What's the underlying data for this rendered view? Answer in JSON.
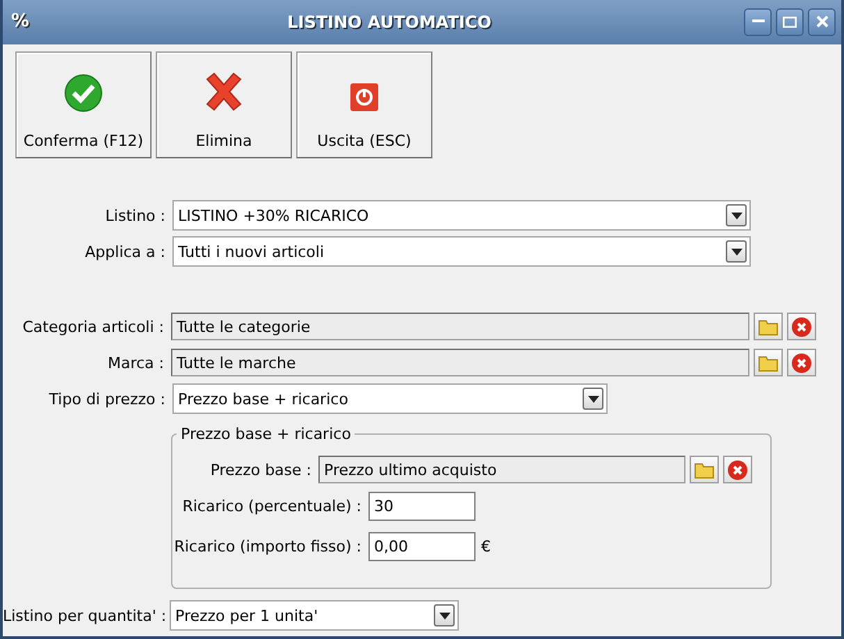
{
  "window": {
    "title": "LISTINO AUTOMATICO",
    "icon": "%"
  },
  "toolbar": [
    {
      "label": "Conferma (F12)",
      "kind": "confirm"
    },
    {
      "label": "Elimina",
      "kind": "delete"
    },
    {
      "label": "Uscita (ESC)",
      "kind": "exit"
    }
  ],
  "form": [
    {
      "kind": "dropdown",
      "label": "Listino :",
      "value": "LISTINO +30% RICARICO"
    },
    {
      "kind": "dropdown",
      "label": "Applica a :",
      "value": "Tutti i nuovi articoli"
    },
    {
      "kind": "spacer"
    },
    {
      "kind": "lookup",
      "label": "Categoria articoli :",
      "value": "Tutte le categorie"
    },
    {
      "kind": "lookup",
      "label": "Marca :",
      "value": "Tutte le marche"
    },
    {
      "kind": "dropdown",
      "label": "Tipo di prezzo :",
      "value": "Prezzo base + ricarico"
    }
  ],
  "group": {
    "title": "Prezzo base + ricarico",
    "rows": [
      {
        "kind": "lookup",
        "label": "Prezzo base :",
        "value": "Prezzo ultimo acquisto"
      },
      {
        "kind": "input",
        "label": "Ricarico (percentuale) :",
        "value": "30"
      },
      {
        "kind": "input",
        "label": "Ricarico (importo fisso) :",
        "value": "0,00",
        "unit": "€"
      }
    ]
  },
  "footer": {
    "kind": "dropdown",
    "label": "Listino per quantita' :",
    "value": "Prezzo per 1 unita'"
  }
}
